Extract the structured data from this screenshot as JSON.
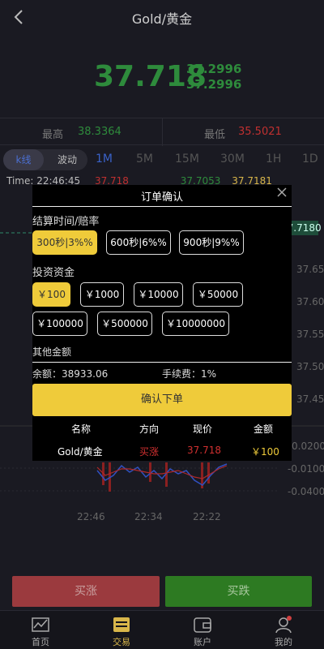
{
  "header": {
    "title": "Gold/黄金",
    "back_icon": "chevron-left-icon"
  },
  "price": {
    "main": "37.718",
    "sub1": "37.2996",
    "sub2": "37.2996"
  },
  "stats": {
    "high_label": "最高",
    "high_value": "38.3364",
    "low_label": "最低",
    "low_value": "35.5021"
  },
  "chart_tabs": {
    "kline": "k线",
    "volatility": "波动"
  },
  "timeframes": [
    "1M",
    "5M",
    "15M",
    "30M",
    "1H",
    "1D"
  ],
  "active_timeframe": "1M",
  "time_row": {
    "label": "Time: 22:46:45",
    "v1": "37.718",
    "v2": "37.7053",
    "v3": "37.7181"
  },
  "price_axis": [
    "37.7180",
    "37.6500",
    "37.6000",
    "37.5500",
    "37.5000",
    "37.4500"
  ],
  "sub_axis": [
    "0.0200",
    "-0.0100",
    "-0.0400"
  ],
  "time_axis": [
    "22:46",
    "22:34",
    "22:22"
  ],
  "trade": {
    "buy_label": "买涨",
    "sell_label": "买跌"
  },
  "nav": [
    {
      "label": "首页",
      "icon": "chart-line-icon"
    },
    {
      "label": "交易",
      "icon": "trade-card-icon"
    },
    {
      "label": "账户",
      "icon": "wallet-icon"
    },
    {
      "label": "我的",
      "icon": "user-icon"
    }
  ],
  "modal": {
    "title": "订单确认",
    "settle_label": "结算时间/赔率",
    "settle_options": [
      "300秒|3%%",
      "600秒|6%%",
      "900秒|9%%"
    ],
    "invest_label": "投资资金",
    "invest_options": [
      "￥100",
      "￥1000",
      "￥10000",
      "￥50000",
      "￥100000",
      "￥500000",
      "￥10000000"
    ],
    "other_label": "其他金额",
    "balance": "余额：38933.06",
    "fee": "手续费：1%",
    "confirm_label": "确认下单",
    "table_headers": [
      "名称",
      "方向",
      "现价",
      "金额"
    ],
    "table_row": [
      "Gold/黄金",
      "买涨",
      "37.718",
      "￥100"
    ]
  },
  "colors": {
    "accent": "#efcb3a",
    "up": "#c03030",
    "down": "#2e8b3c",
    "blue": "#3a62c8"
  }
}
